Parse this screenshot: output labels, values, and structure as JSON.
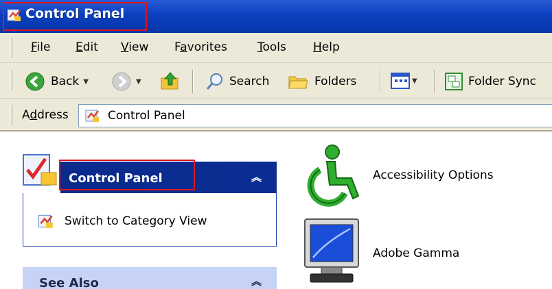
{
  "window": {
    "title": "Control Panel"
  },
  "menu": {
    "items": [
      {
        "label": "File",
        "key": "F",
        "rest": "ile"
      },
      {
        "label": "Edit",
        "key": "E",
        "rest": "dit"
      },
      {
        "label": "View",
        "key": "V",
        "rest": "iew"
      },
      {
        "label": "Favorites",
        "pre": "F",
        "key": "a",
        "rest": "vorites"
      },
      {
        "label": "Tools",
        "key": "T",
        "rest": "ools"
      },
      {
        "label": "Help",
        "key": "H",
        "rest": "elp"
      }
    ]
  },
  "toolbar": {
    "back_label": "Back",
    "search_label": "Search",
    "folders_label": "Folders",
    "folder_sync_label": "Folder Sync"
  },
  "address": {
    "label_pre": "A",
    "label_key": "d",
    "label_rest": "dress",
    "value": "Control Panel"
  },
  "task_pane": {
    "title": "Control Panel",
    "link_switch": "Switch to Category View",
    "see_also_title": "See Also"
  },
  "items": [
    {
      "label": "Accessibility Options",
      "icon": "accessibility-icon"
    },
    {
      "label": "Adobe Gamma",
      "icon": "monitor-icon"
    }
  ],
  "colors": {
    "title_bar": "#0a3fbf",
    "highlight": "#e0141e",
    "pane_header": "#0a2a8c",
    "chrome": "#ece9d8"
  }
}
